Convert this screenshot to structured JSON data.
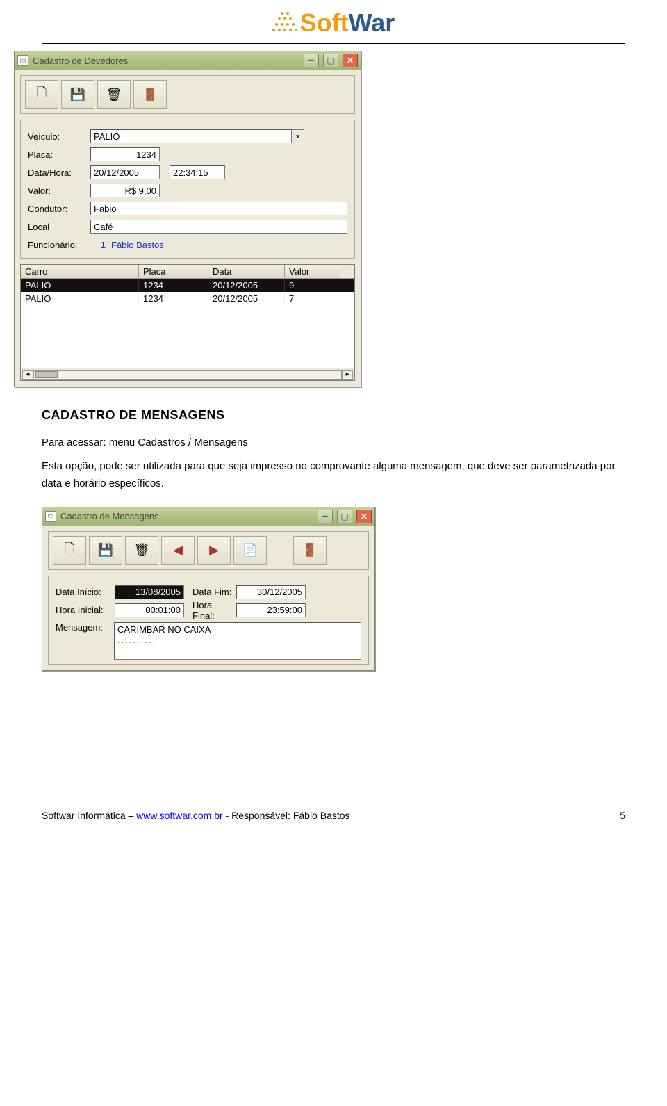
{
  "header": {
    "logo_soft": "Soft",
    "logo_war": "War"
  },
  "win1": {
    "title": "Cadastro de Devedores",
    "toolbar_icons": [
      "new-icon",
      "save-icon",
      "delete-icon",
      "exit-icon"
    ],
    "fields": {
      "veiculo_lbl": "Veículo:",
      "veiculo_val": "PALIO",
      "placa_lbl": "Placa:",
      "placa_val": "1234",
      "data_lbl": "Data/Hora:",
      "data_val": "20/12/2005",
      "hora_val": "22:34:15",
      "valor_lbl": "Valor:",
      "valor_val": "R$ 9,00",
      "condutor_lbl": "Condutor:",
      "condutor_val": "Fabio",
      "local_lbl": "Local",
      "local_val": "Café",
      "func_lbl": "Funcionário:",
      "func_id": "1",
      "func_nome": "Fábio Bastos"
    },
    "grid": {
      "headers": [
        "Carro",
        "Placa",
        "Data",
        "Valor"
      ],
      "rows": [
        {
          "sel": true,
          "cells": [
            "PALIO",
            "1234",
            "20/12/2005",
            "9"
          ]
        },
        {
          "sel": false,
          "cells": [
            "PALIO",
            "1234",
            "20/12/2005",
            "7"
          ]
        }
      ]
    }
  },
  "section1": {
    "title": "CADASTRO DE MENSAGENS",
    "line1": "Para acessar: menu Cadastros / Mensagens",
    "line2": "Esta opção, pode ser utilizada para que seja impresso no comprovante alguma mensagem, que deve ser parametrizada por data e horário específicos."
  },
  "win2": {
    "title": "Cadastro de Mensagens",
    "fields": {
      "di_lbl": "Data Início:",
      "di_val": "13/08/2005",
      "df_lbl": "Data Fim:",
      "df_val": "30/12/2005",
      "hi_lbl": "Hora Inicial:",
      "hi_val": "00:01:00",
      "hf_lbl": "Hora Final:",
      "hf_val": "23:59:00",
      "msg_lbl": "Mensagem:",
      "msg_val": "CARIMBAR NO CAIXA"
    }
  },
  "footer": {
    "left_pre": "Softwar Informática – ",
    "link": "www.softwar.com.br",
    "left_post": " - Responsável: Fábio Bastos",
    "page": "5"
  }
}
